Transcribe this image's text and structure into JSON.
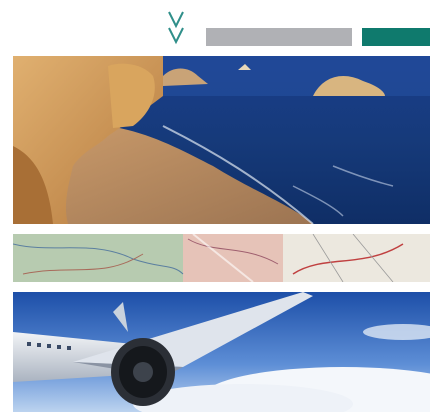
{
  "header": {
    "chevron_icon": "double-chevron-down-icon",
    "bar_gray_color": "#b0b1b5",
    "bar_teal_color": "#0f7a6d"
  },
  "panels": [
    {
      "name": "beach-coast-photo",
      "subject": "coastline"
    },
    {
      "name": "map-strip-photo",
      "subject": "map"
    },
    {
      "name": "airplane-photo",
      "subject": "airplane"
    }
  ]
}
